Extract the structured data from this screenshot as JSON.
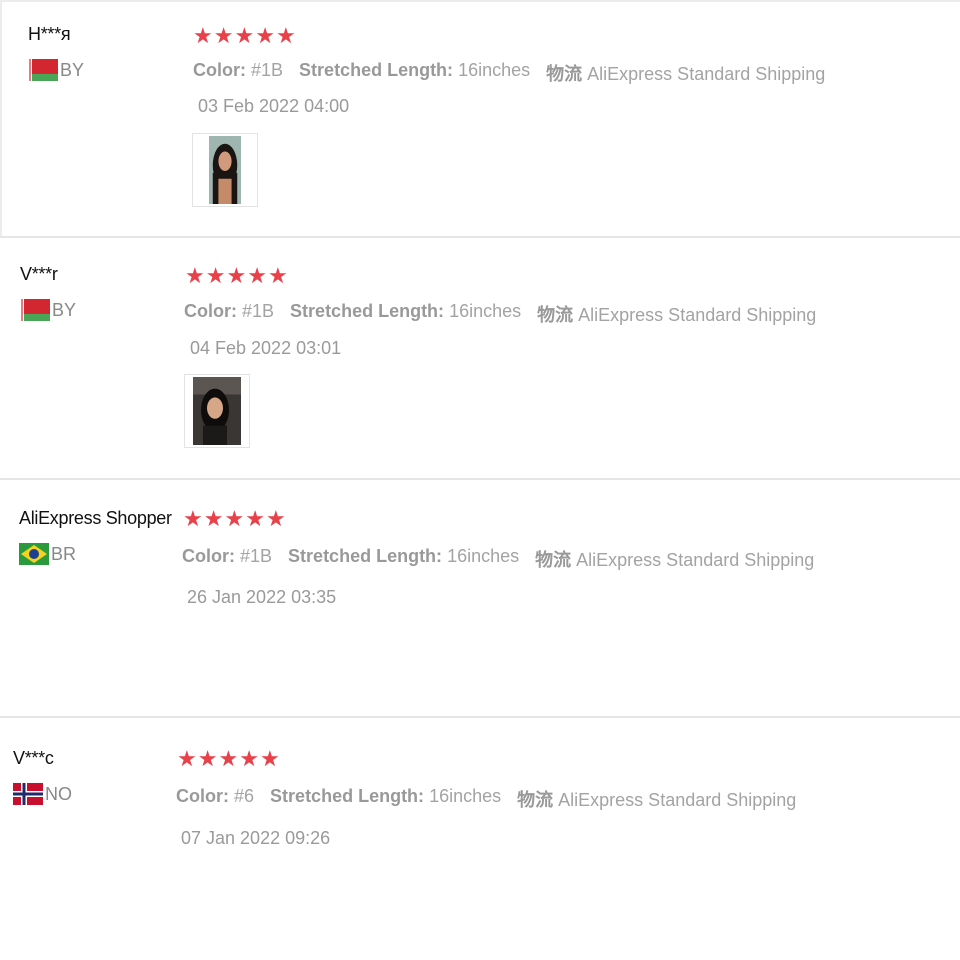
{
  "reviews": [
    {
      "username": "H***я",
      "country_code": "BY",
      "flag": "belarus-flag",
      "rating": 5,
      "stars": "★★★★★",
      "color_label": "Color:",
      "color_value": "#1B",
      "length_label": "Stretched Length:",
      "length_value": "16inches",
      "shipping_label": "物流",
      "shipping_value": "AliExpress Standard Shipping",
      "date": "03 Feb 2022 04:00",
      "has_photo": true
    },
    {
      "username": "V***r",
      "country_code": "BY",
      "flag": "belarus-flag",
      "rating": 5,
      "stars": "★★★★★",
      "color_label": "Color:",
      "color_value": "#1B",
      "length_label": "Stretched Length:",
      "length_value": "16inches",
      "shipping_label": "物流",
      "shipping_value": "AliExpress Standard Shipping",
      "date": "04 Feb 2022 03:01",
      "has_photo": true
    },
    {
      "username": "AliExpress Shopper",
      "country_code": "BR",
      "flag": "brazil-flag",
      "rating": 5,
      "stars": "★★★★★",
      "color_label": "Color:",
      "color_value": "#1B",
      "length_label": "Stretched Length:",
      "length_value": "16inches",
      "shipping_label": "物流",
      "shipping_value": "AliExpress Standard Shipping",
      "date": "26 Jan 2022 03:35",
      "has_photo": false
    },
    {
      "username": "V***c",
      "country_code": "NO",
      "flag": "norway-flag",
      "rating": 5,
      "stars": "★★★★★",
      "color_label": "Color:",
      "color_value": "#6",
      "length_label": "Stretched Length:",
      "length_value": "16inches",
      "shipping_label": "物流",
      "shipping_value": "AliExpress Standard Shipping",
      "date": "07 Jan 2022 09:26",
      "has_photo": false
    }
  ],
  "colors": {
    "star": "#e9414a",
    "meta_text": "#999999",
    "divider": "#e6e6e6"
  }
}
